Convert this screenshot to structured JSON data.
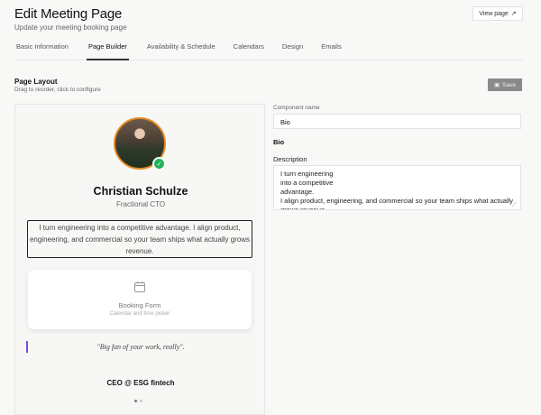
{
  "header": {
    "title": "Edit Meeting Page",
    "subtitle": "Update your meeting booking page",
    "view_page": "View page"
  },
  "tabs": [
    {
      "label": "Basic Information"
    },
    {
      "label": "Page Builder",
      "active": true
    },
    {
      "label": "Availability & Schedule"
    },
    {
      "label": "Calendars"
    },
    {
      "label": "Design"
    },
    {
      "label": "Emails"
    }
  ],
  "layout": {
    "title": "Page Layout",
    "subtitle": "Drag to reorder, click to configure",
    "save": "Save"
  },
  "preview": {
    "name": "Christian Schulze",
    "role": "Fractional CTO",
    "bio": "I turn engineering into a competitive advantage. I align product, engineering, and commercial so your team ships what actually grows revenue.",
    "booking_title": "Booking Form",
    "booking_sub": "Calendar and time picker",
    "quote": "\"Big fan of your work, really\".",
    "testimonial_author": "CEO @ ESG fintech"
  },
  "config": {
    "component_name_label": "Component name",
    "component_name_value": "Bio",
    "section_title": "Bio",
    "description_label": "Description",
    "description_value": "I turn engineering\ninto a competitive\nadvantage.\nI align product, engineering, and commercial so your team ships what actually grows revenue."
  }
}
